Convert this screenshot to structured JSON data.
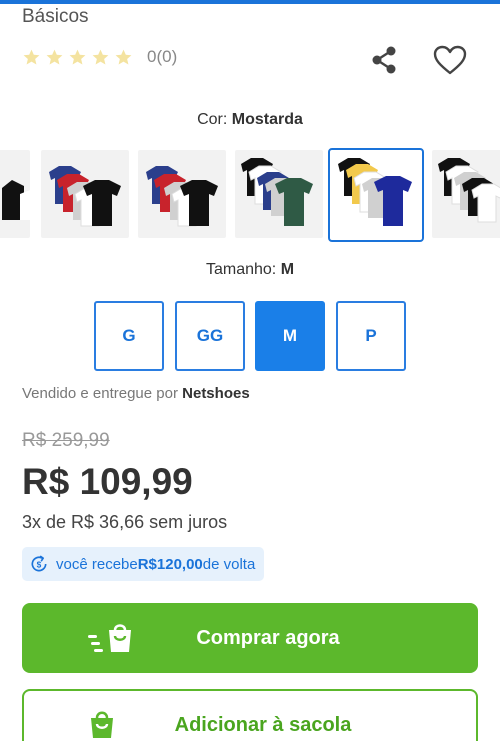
{
  "product": {
    "title": "Básicos",
    "rating_count": "0(0)",
    "stars": 0
  },
  "color": {
    "label": "Cor: ",
    "value": "Mostarda"
  },
  "variants": [
    {
      "name": "variant-thumb-partial",
      "colors": [
        "#1a1a1a",
        "#ffffff"
      ]
    },
    {
      "name": "variant-thumb-1",
      "colors": [
        "#2b3f8c",
        "#c8232c",
        "#d9d9d9",
        "#ffffff",
        "#111111"
      ]
    },
    {
      "name": "variant-thumb-2",
      "colors": [
        "#2b3f8c",
        "#c8232c",
        "#d9d9d9",
        "#ffffff",
        "#111111"
      ]
    },
    {
      "name": "variant-thumb-3",
      "colors": [
        "#111111",
        "#ffffff",
        "#2b3f8c",
        "#d9d9d9",
        "#2f5a45"
      ]
    },
    {
      "name": "variant-thumb-mostarda",
      "colors": [
        "#111111",
        "#f2c94c",
        "#ffffff",
        "#d9d9d9",
        "#1e2a9c"
      ]
    },
    {
      "name": "variant-thumb-5",
      "colors": [
        "#111111",
        "#ffffff",
        "#d9d9d9",
        "#111111",
        "#ffffff"
      ]
    }
  ],
  "size": {
    "label": "Tamanho: ",
    "value": "M",
    "options": [
      "G",
      "GG",
      "M",
      "P"
    ]
  },
  "seller": {
    "prefix": "Vendido e entregue por ",
    "name": "Netshoes"
  },
  "pricing": {
    "old_price": "R$ 259,99",
    "price": "R$ 109,99",
    "installments": "3x de R$ 36,66 sem juros"
  },
  "cashback": {
    "prefix": "você recebe ",
    "amount": "R$120,00",
    "suffix": " de volta"
  },
  "actions": {
    "buy_now": "Comprar agora",
    "add_to_bag": "Adicionar à sacola"
  },
  "colors": {
    "accent": "#1a73d9",
    "buy_green": "#5cb82c",
    "star": "#f4e3a0"
  }
}
